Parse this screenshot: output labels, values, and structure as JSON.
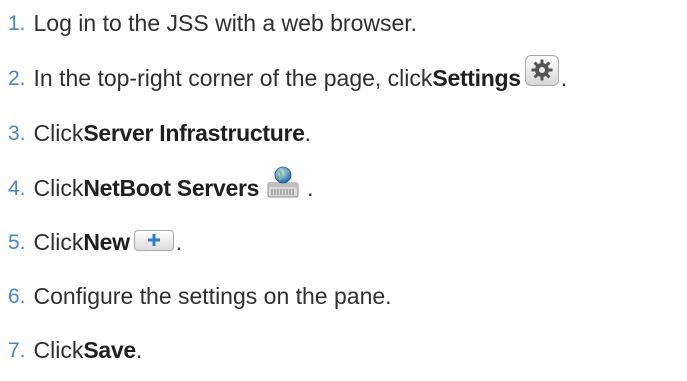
{
  "steps": [
    {
      "number": "1.",
      "text": "Log in to the JSS with a web browser."
    },
    {
      "number": "2.",
      "before": "In the top-right corner of the page, click ",
      "bold": "Settings",
      "icon": "settings-gear-icon",
      "after": "."
    },
    {
      "number": "3.",
      "before": "Click ",
      "bold": "Server Infrastructure",
      "after": "."
    },
    {
      "number": "4.",
      "before": "Click ",
      "bold": "NetBoot Servers",
      "icon": "netboot-server-icon",
      "after": "."
    },
    {
      "number": "5.",
      "before": "Click ",
      "bold": "New",
      "icon": "plus-icon",
      "after": "."
    },
    {
      "number": "6.",
      "text": "Configure the settings on the pane."
    },
    {
      "number": "7.",
      "before": "Click ",
      "bold": "Save",
      "after": "."
    }
  ],
  "colors": {
    "step_number": "#4a86c5",
    "text": "#2f2f2f",
    "bold_text": "#1f1f1f"
  }
}
